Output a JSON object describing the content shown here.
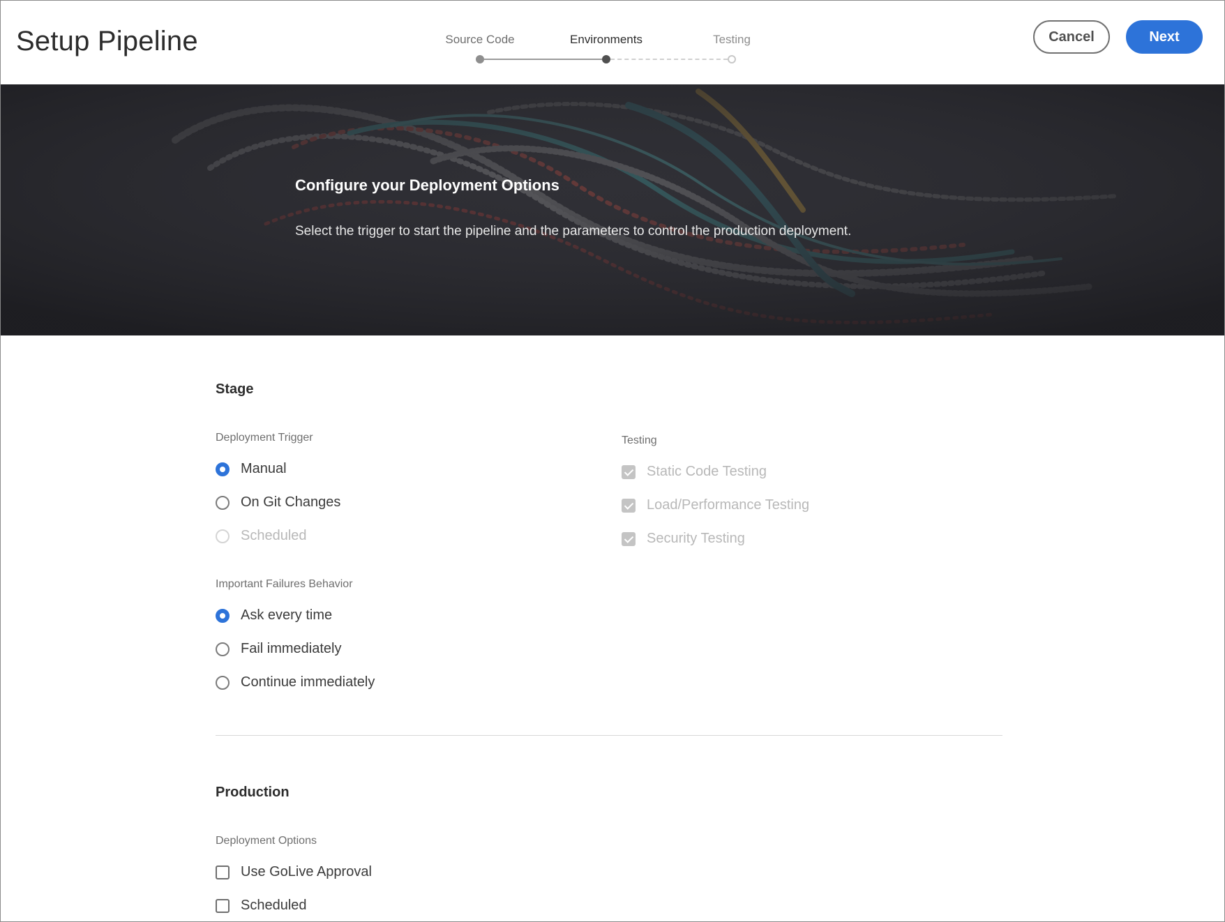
{
  "header": {
    "title": "Setup Pipeline",
    "steps": [
      {
        "label": "Source Code",
        "state": "done"
      },
      {
        "label": "Environments",
        "state": "current"
      },
      {
        "label": "Testing",
        "state": "todo"
      }
    ],
    "cancel_label": "Cancel",
    "next_label": "Next"
  },
  "hero": {
    "title": "Configure your Deployment Options",
    "subtitle": "Select the trigger to start the pipeline and the parameters to control the production deployment."
  },
  "stage": {
    "title": "Stage",
    "deployment_trigger": {
      "label": "Deployment Trigger",
      "options": [
        {
          "label": "Manual",
          "checked": true,
          "disabled": false
        },
        {
          "label": "On Git Changes",
          "checked": false,
          "disabled": false
        },
        {
          "label": "Scheduled",
          "checked": false,
          "disabled": true
        }
      ]
    },
    "failures": {
      "label": "Important Failures Behavior",
      "options": [
        {
          "label": "Ask every time",
          "checked": true
        },
        {
          "label": "Fail immediately",
          "checked": false
        },
        {
          "label": "Continue immediately",
          "checked": false
        }
      ]
    },
    "testing": {
      "label": "Testing",
      "options": [
        {
          "label": "Static Code Testing",
          "checked": true,
          "disabled": true
        },
        {
          "label": "Load/Performance Testing",
          "checked": true,
          "disabled": true
        },
        {
          "label": "Security Testing",
          "checked": true,
          "disabled": true
        }
      ]
    }
  },
  "production": {
    "title": "Production",
    "deployment_options": {
      "label": "Deployment Options",
      "options": [
        {
          "label": "Use GoLive Approval",
          "checked": false
        },
        {
          "label": "Scheduled",
          "checked": false
        }
      ]
    }
  },
  "colors": {
    "accent": "#2d73d9",
    "hero_bg": "#25252b"
  }
}
